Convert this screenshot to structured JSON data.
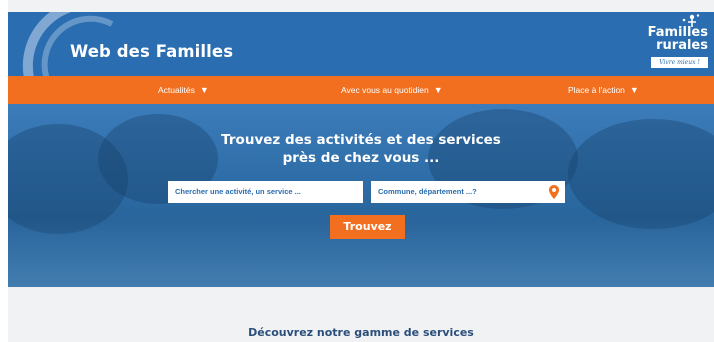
{
  "header": {
    "site_title": "Web des Familles",
    "logo_line1": "Familles",
    "logo_line2": "rurales",
    "logo_tagline": "Vivre mieux !"
  },
  "nav": {
    "items": [
      {
        "label": "Actualités",
        "caret": "▼"
      },
      {
        "label": "Avec vous au quotidien",
        "caret": "▼"
      },
      {
        "label": "Place à l'action",
        "caret": "▼"
      }
    ]
  },
  "hero": {
    "title_line1": "Trouvez des activités et des services",
    "title_line2": "près de chez vous ...",
    "activity_placeholder": "Chercher une activité, un service ...",
    "location_placeholder": "Commune, département ...?",
    "search_button": "Trouvez"
  },
  "services": {
    "heading": "Découvrez notre gamme de services"
  },
  "colors": {
    "brand_blue": "#2a6db0",
    "accent_orange": "#f26f1f",
    "heading_navy": "#2b4f7a"
  },
  "icons": {
    "location": "map-pin-icon",
    "nav_caret": "caret-down-icon"
  }
}
